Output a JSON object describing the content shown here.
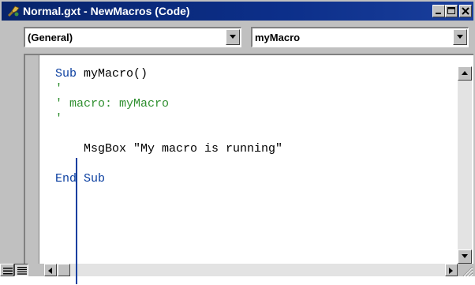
{
  "window": {
    "title": "Normal.gxt - NewMacros (Code)"
  },
  "object_combo": {
    "value": "(General)"
  },
  "procedure_combo": {
    "value": "myMacro"
  },
  "code_lines": [
    {
      "parts": [
        {
          "cls": "kw",
          "text": "Sub"
        },
        {
          "cls": "tx",
          "text": " myMacro()"
        }
      ]
    },
    {
      "parts": [
        {
          "cls": "cm",
          "text": "'"
        }
      ]
    },
    {
      "parts": [
        {
          "cls": "cm",
          "text": "' macro: myMacro"
        }
      ]
    },
    {
      "parts": [
        {
          "cls": "cm",
          "text": "'"
        }
      ]
    },
    {
      "parts": []
    },
    {
      "parts": [
        {
          "cls": "tx",
          "text": "    MsgBox \"My macro is running\""
        }
      ]
    },
    {
      "parts": []
    },
    {
      "parts": [
        {
          "cls": "kw",
          "text": "End Sub"
        }
      ]
    }
  ],
  "colors": {
    "titlebar": "#0a246a",
    "keyword": "#0b3fa0",
    "comment": "#2f8f2f",
    "chrome": "#c0c0c0"
  },
  "icons": {
    "app": "vba-app-icon",
    "minimize": "minimize-icon",
    "maximize": "maximize-icon",
    "close": "close-icon",
    "dropdown": "chevron-down-icon",
    "scroll_up": "arrow-up-icon",
    "scroll_down": "arrow-down-icon",
    "scroll_left": "arrow-left-icon",
    "scroll_right": "arrow-right-icon",
    "procedure_view": "procedure-view-icon",
    "full_module_view": "full-module-view-icon"
  }
}
